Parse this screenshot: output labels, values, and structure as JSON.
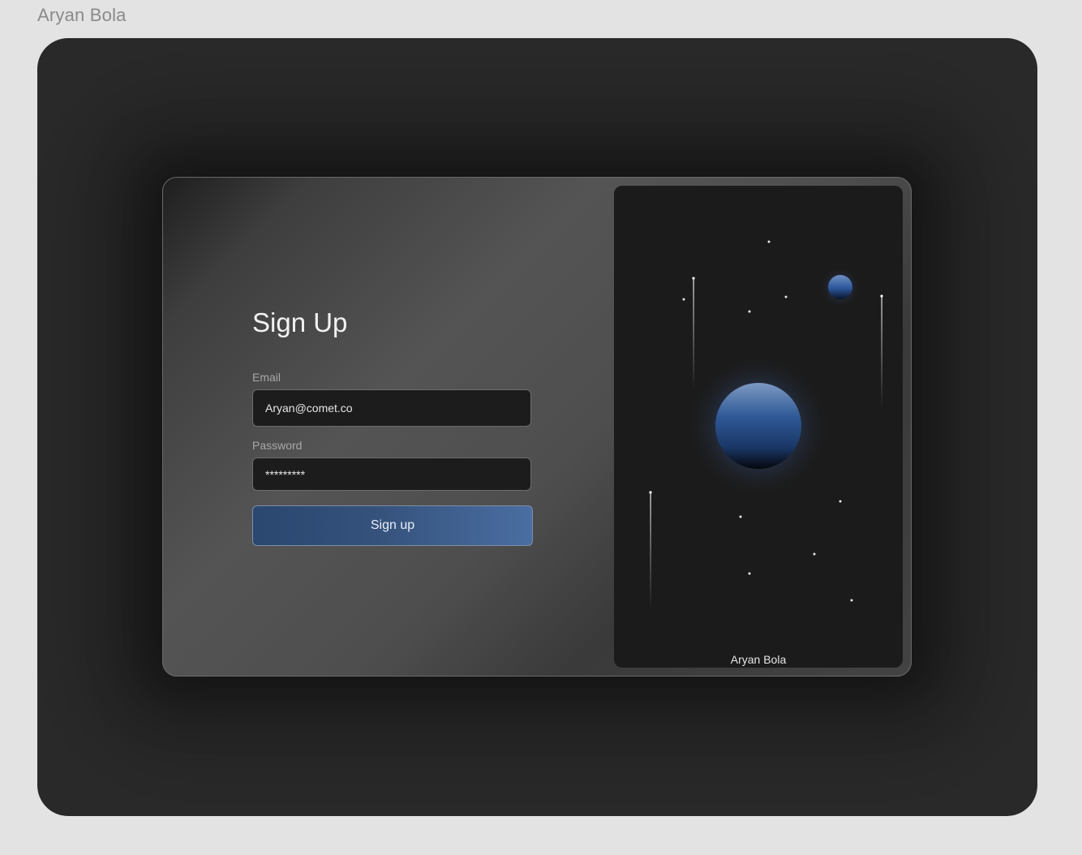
{
  "frame": {
    "label": "Aryan Bola"
  },
  "form": {
    "title": "Sign Up",
    "email_label": "Email",
    "email_value": "Aryan@comet.co",
    "password_label": "Password",
    "password_value": "*********",
    "submit_label": "Sign up"
  },
  "art": {
    "credit": "Aryan Bola"
  },
  "colors": {
    "accent": "#35527c",
    "planet": "#2e5896",
    "background": "#2a2a2a"
  }
}
